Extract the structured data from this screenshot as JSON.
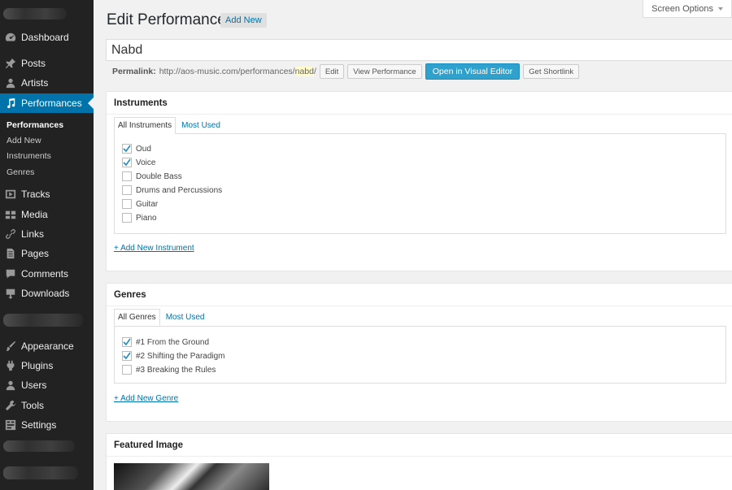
{
  "sidebar": {
    "items": [
      {
        "label": "Dashboard",
        "icon": "dashboard-icon"
      },
      {
        "label": "Posts",
        "icon": "pushpin-icon"
      },
      {
        "label": "Artists",
        "icon": "user-icon"
      },
      {
        "label": "Performances",
        "icon": "music-note-icon"
      },
      {
        "label": "Tracks",
        "icon": "video-icon"
      },
      {
        "label": "Media",
        "icon": "media-icon"
      },
      {
        "label": "Links",
        "icon": "link-icon"
      },
      {
        "label": "Pages",
        "icon": "page-icon"
      },
      {
        "label": "Comments",
        "icon": "comment-icon"
      },
      {
        "label": "Downloads",
        "icon": "download-icon"
      },
      {
        "label": "Appearance",
        "icon": "brush-icon"
      },
      {
        "label": "Plugins",
        "icon": "plugin-icon"
      },
      {
        "label": "Users",
        "icon": "users-icon"
      },
      {
        "label": "Tools",
        "icon": "wrench-icon"
      },
      {
        "label": "Settings",
        "icon": "settings-icon"
      }
    ],
    "submenu": [
      "Performances",
      "Add New",
      "Instruments",
      "Genres"
    ]
  },
  "header": {
    "title": "Edit Performance",
    "add_new": "Add New",
    "screen_options": "Screen Options"
  },
  "post": {
    "title_value": "Nabd",
    "permalink_label": "Permalink:",
    "permalink_base": "http://aos-music.com/performances/",
    "permalink_slug": "nabd",
    "permalink_trail": "/",
    "edit_btn": "Edit",
    "view_btn": "View Performance",
    "visual_btn": "Open in Visual Editor",
    "shortlink_btn": "Get Shortlink"
  },
  "instruments": {
    "title": "Instruments",
    "tab_all": "All Instruments",
    "tab_used": "Most Used",
    "items": [
      {
        "label": "Oud",
        "checked": true
      },
      {
        "label": "Voice",
        "checked": true
      },
      {
        "label": "Double Bass",
        "checked": false
      },
      {
        "label": "Drums and Percussions",
        "checked": false
      },
      {
        "label": "Guitar",
        "checked": false
      },
      {
        "label": "Piano",
        "checked": false
      }
    ],
    "add_link": "+ Add New Instrument"
  },
  "genres": {
    "title": "Genres",
    "tab_all": "All Genres",
    "tab_used": "Most Used",
    "items": [
      {
        "label": "#1 From the Ground",
        "checked": true
      },
      {
        "label": "#2 Shifting the Paradigm",
        "checked": true
      },
      {
        "label": "#3 Breaking the Rules",
        "checked": false
      }
    ],
    "add_link": "+ Add New Genre"
  },
  "featured": {
    "title": "Featured Image"
  },
  "colors": {
    "accent": "#0073aa",
    "primary_button": "#2ea2cc",
    "sidebar_bg": "#222222"
  }
}
